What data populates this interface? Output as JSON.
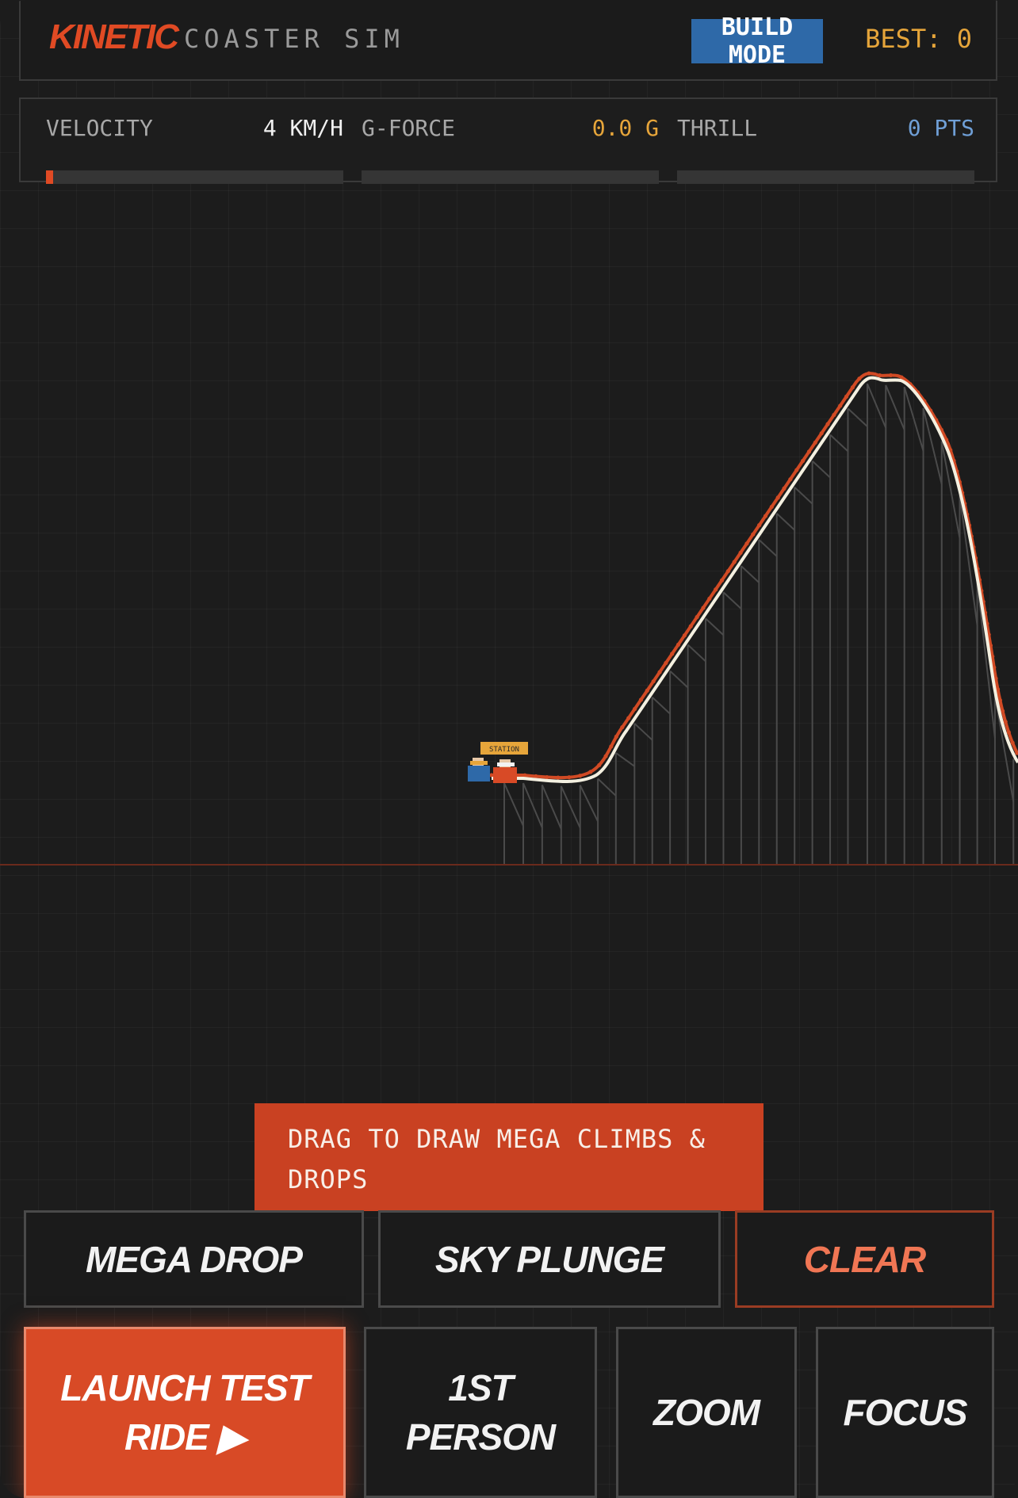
{
  "header": {
    "logo": "KINETIC",
    "subtitle": "COASTER SIM",
    "mode_button": "BUILD MODE",
    "best_label": "BEST:",
    "best_value": "0"
  },
  "stats": [
    {
      "label": "VELOCITY",
      "value": "4 KM/H",
      "value_color": "#f0f0f0",
      "fill_fraction": 0.025
    },
    {
      "label": "G-FORCE",
      "value": "0.0 G",
      "value_color": "#e6a53a",
      "fill_fraction": 0
    },
    {
      "label": "THRILL",
      "value": "0 PTS",
      "value_color": "#6f9fd6",
      "fill_fraction": 0
    }
  ],
  "track": {
    "station_label": "STATION",
    "rail_color": "#f4f0e0",
    "accent_rail_color": "#d14a24",
    "ground_color": "#6a2a1c"
  },
  "hint": "DRAG TO DRAW MEGA CLIMBS & DROPS",
  "presets": {
    "mega_drop": "MEGA DROP",
    "sky_plunge": "SKY PLUNGE",
    "clear": "CLEAR"
  },
  "controls": {
    "launch_line1": "LAUNCH TEST",
    "launch_line2": "RIDE ▶",
    "first_person_line1": "1ST",
    "first_person_line2": "PERSON",
    "zoom": "ZOOM",
    "focus": "FOCUS"
  },
  "colors": {
    "accent": "#e04a24",
    "mode_blue": "#2e69a8",
    "best_gold": "#e6a53a"
  }
}
